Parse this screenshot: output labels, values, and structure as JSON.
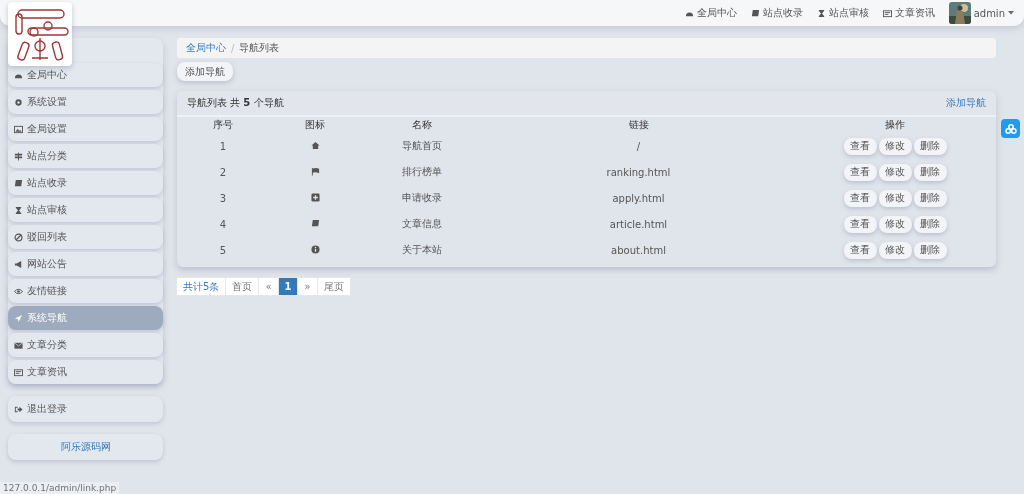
{
  "topnav": {
    "links": [
      {
        "label": "全局中心"
      },
      {
        "label": "站点收录"
      },
      {
        "label": "站点审核"
      },
      {
        "label": "文章资讯"
      }
    ],
    "user": "admin"
  },
  "sidebar": {
    "items": [
      {
        "label": "全局中心",
        "selected": false
      },
      {
        "label": "系统设置",
        "selected": false
      },
      {
        "label": "全局设置",
        "selected": false
      },
      {
        "label": "站点分类",
        "selected": false
      },
      {
        "label": "站点收录",
        "selected": false
      },
      {
        "label": "站点审核",
        "selected": false
      },
      {
        "label": "驳回列表",
        "selected": false
      },
      {
        "label": "网站公告",
        "selected": false
      },
      {
        "label": "友情链接",
        "selected": false
      },
      {
        "label": "系统导航",
        "selected": true
      },
      {
        "label": "文章分类",
        "selected": false
      },
      {
        "label": "文章资讯",
        "selected": false
      }
    ],
    "logout": "退出登录",
    "footer_link": "阿乐源码网"
  },
  "breadcrumb": {
    "separator": "/",
    "items": [
      {
        "label": "全局中心"
      },
      {
        "label": "导航列表"
      }
    ]
  },
  "add_button": "添加导航",
  "panel": {
    "title": "导航列表 共 **5** 个导航",
    "action": "添加导航",
    "table": {
      "columns": [
        "序号",
        "图标",
        "名称",
        "链接",
        "操作"
      ],
      "rows": [
        {
          "index": "1",
          "name": "导航首页",
          "link": "/",
          "actions": [
            "查看",
            "修改",
            "删除"
          ]
        },
        {
          "index": "2",
          "name": "排行榜单",
          "link": "ranking.html",
          "actions": [
            "查看",
            "修改",
            "删除"
          ]
        },
        {
          "index": "3",
          "name": "申请收录",
          "link": "apply.html",
          "actions": [
            "查看",
            "修改",
            "删除"
          ]
        },
        {
          "index": "4",
          "name": "文章信息",
          "link": "article.html",
          "actions": [
            "查看",
            "修改",
            "删除"
          ]
        },
        {
          "index": "5",
          "name": "关于本站",
          "link": "about.html",
          "actions": [
            "查看",
            "修改",
            "删除"
          ]
        }
      ]
    }
  },
  "pagination": {
    "items": [
      {
        "label": "共计5条",
        "selected": false
      },
      {
        "label": "首页",
        "selected": false
      },
      {
        "label": "«",
        "selected": false
      },
      {
        "label": "1",
        "selected": true
      },
      {
        "label": "»",
        "selected": false
      },
      {
        "label": "尾页",
        "selected": false
      }
    ]
  },
  "status_url": "127.0.0.1/admin/link.php"
}
